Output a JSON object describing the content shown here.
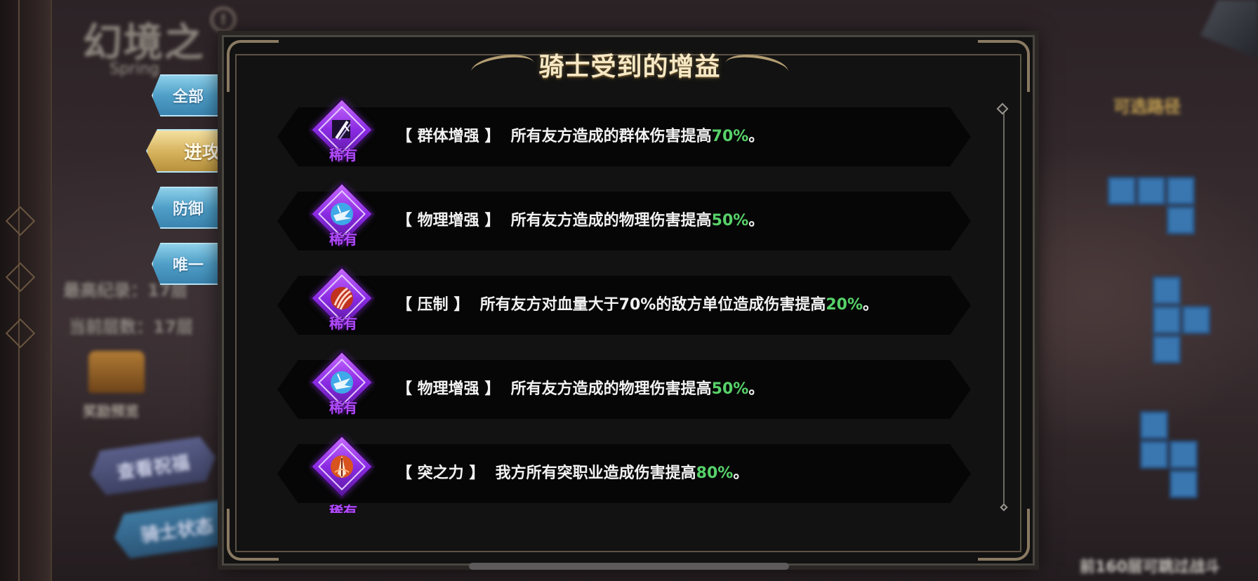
{
  "background": {
    "title": "幻境之",
    "subtitle": "Spring",
    "alert_glyph": "!",
    "stat_best": "最高纪录：17层",
    "stat_current": "当前层数：17层",
    "chest_label": "奖励预览",
    "btn_blessing": "查看祝福",
    "btn_knight": "骑士状态",
    "route_title": "可选路径",
    "bottom_hint": "前160层可跳过战斗"
  },
  "tabs": [
    {
      "label": "全部"
    },
    {
      "label": "进攻"
    },
    {
      "label": "防御"
    },
    {
      "label": "唯一"
    }
  ],
  "dialog": {
    "title": "骑士受到的增益"
  },
  "buffs": [
    {
      "name": "【 群体增强 】",
      "desc": "所有友方造成的群体伤害提高",
      "value": "70%",
      "end": "。",
      "rarity": "稀有",
      "icon": "sword-slash-icon",
      "color": "#8a2be2"
    },
    {
      "name": "【 物理增强 】",
      "desc": "所有友方造成的物理伤害提高",
      "value": "50%",
      "end": "。",
      "rarity": "稀有",
      "icon": "physical-burst-icon",
      "color": "#8a2be2"
    },
    {
      "name": "【 压制 】",
      "desc": "所有友方对血量大于70%的敌方单位造成伤害提高",
      "value": "20%",
      "end": "。",
      "rarity": "稀有",
      "icon": "claw-strike-icon",
      "color": "#8a2be2"
    },
    {
      "name": "【 物理增强 】",
      "desc": "所有友方造成的物理伤害提高",
      "value": "50%",
      "end": "。",
      "rarity": "稀有",
      "icon": "physical-burst-icon",
      "color": "#8a2be2"
    },
    {
      "name": "【 突之力 】",
      "desc": "我方所有突职业造成伤害提高",
      "value": "80%",
      "end": "。",
      "rarity": "稀有",
      "icon": "lance-flame-icon",
      "color": "#8a2be2"
    }
  ],
  "colors": {
    "highlight": "#57d26a",
    "rarity_text": "#b24cff",
    "tab_active": "#d8b560",
    "tab_inactive": "#4f9fc8"
  }
}
